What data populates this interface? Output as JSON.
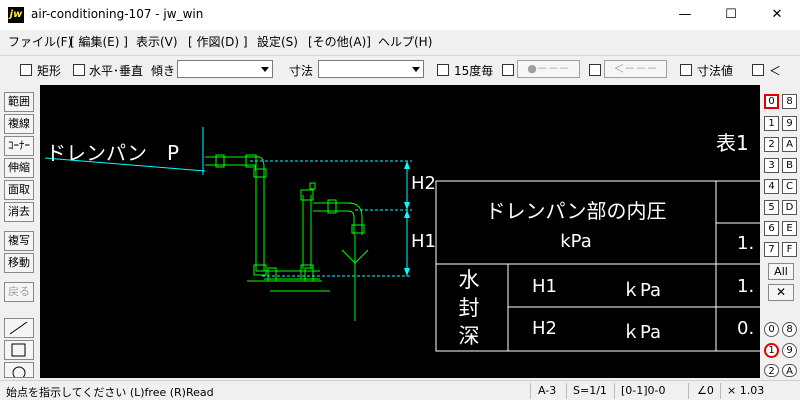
{
  "window": {
    "title": "air-conditioning-107 - jw_win",
    "icon_text": "jw",
    "minimize": "—",
    "maximize": "☐",
    "close": "✕"
  },
  "menu": [
    "ファイル(F)",
    "[ 編集(E) ]",
    "表示(V)",
    "[ 作図(D) ]",
    "設定(S)",
    "[その他(A)]",
    "ヘルプ(H)"
  ],
  "toolbar": {
    "rect_label": "矩形",
    "hv_label": "水平･垂直",
    "angle_label": "傾き",
    "dim_label": "寸法",
    "deg15_label": "15度毎",
    "btn_a": "●－－－",
    "btn_b": "＜－－－",
    "dimval_label": "寸法値",
    "lt_label": "＜"
  },
  "left_tools": [
    "範囲",
    "複線",
    "ｺｰﾅｰ",
    "伸縮",
    "面取",
    "消去",
    "複写",
    "移動",
    "戻る"
  ],
  "right_layers": {
    "group_layers": [
      "0",
      "8",
      "1",
      "9",
      "2",
      "A",
      "3",
      "B",
      "4",
      "C",
      "5",
      "D",
      "6",
      "E",
      "7",
      "F"
    ],
    "all_label": "All",
    "close_icon": "✕",
    "layer_groups": [
      "0",
      "8",
      "1",
      "9",
      "2",
      "A"
    ]
  },
  "drawing": {
    "drain_label": "ドレンパン　P",
    "h2": "H2",
    "h1": "H1",
    "table_title": "表1",
    "table": {
      "header_line1": "ドレンパン部の内圧",
      "header_line2": "kPa",
      "seal_label": [
        "水",
        "封",
        "深"
      ],
      "rows": [
        {
          "name": "H1",
          "unit": "ｋPa",
          "value": "1."
        },
        {
          "name": "H2",
          "unit": "ｋPa",
          "value": "0."
        }
      ],
      "header_value": "1."
    }
  },
  "colors": {
    "canvas_bg": "#000000",
    "pipe": "#00ff00",
    "dimension": "#00ffff",
    "drawing_text": "#ffffff"
  },
  "status": {
    "message": "始点を指示してください (L)free (R)Read",
    "paper": "A-3",
    "scale": "S=1/1",
    "layer": "[0-1]0-0",
    "angle": "∠0",
    "zoom": "× 1.03"
  }
}
